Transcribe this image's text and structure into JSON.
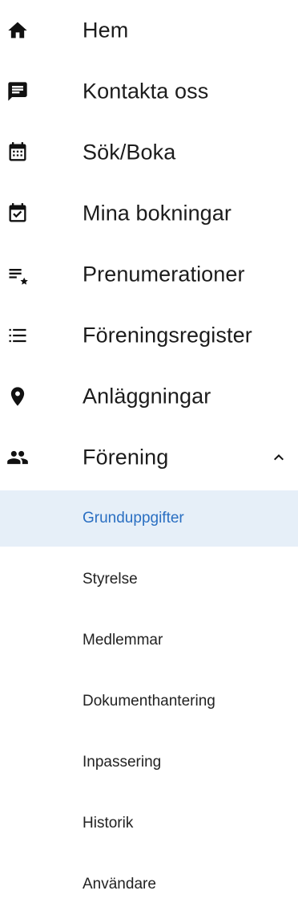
{
  "nav": {
    "items": [
      {
        "label": "Hem",
        "icon": "home-icon"
      },
      {
        "label": "Kontakta oss",
        "icon": "chat-icon"
      },
      {
        "label": "Sök/Boka",
        "icon": "calendar-icon"
      },
      {
        "label": "Mina bokningar",
        "icon": "calendar-check-icon"
      },
      {
        "label": "Prenumerationer",
        "icon": "playlist-star-icon"
      },
      {
        "label": "Föreningsregister",
        "icon": "list-icon"
      },
      {
        "label": "Anläggningar",
        "icon": "location-pin-icon"
      },
      {
        "label": "Förening",
        "icon": "people-icon",
        "expanded": true
      }
    ],
    "sub_items": [
      {
        "label": "Grunduppgifter",
        "active": true
      },
      {
        "label": "Styrelse"
      },
      {
        "label": "Medlemmar"
      },
      {
        "label": "Dokumenthantering"
      },
      {
        "label": "Inpassering"
      },
      {
        "label": "Historik"
      },
      {
        "label": "Användare"
      }
    ]
  },
  "colors": {
    "active_bg": "#e6eff8",
    "active_text": "#2a6fc2",
    "text": "#1c1c1c",
    "icon": "#111111"
  }
}
